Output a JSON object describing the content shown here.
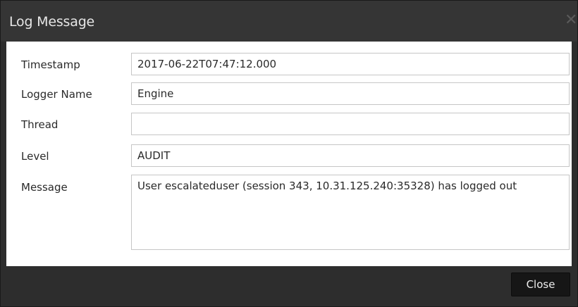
{
  "dialog": {
    "title": "Log Message",
    "close_icon": "close-icon",
    "close_glyph": "✕"
  },
  "fields": {
    "timestamp": {
      "label": "Timestamp",
      "value": "2017-06-22T07:47:12.000"
    },
    "logger_name": {
      "label": "Logger Name",
      "value": "Engine"
    },
    "thread": {
      "label": "Thread",
      "value": ""
    },
    "level": {
      "label": "Level",
      "value": "AUDIT"
    },
    "message": {
      "label": "Message",
      "value": "User escalateduser (session 343, 10.31.125.240:35328) has logged out"
    }
  },
  "footer": {
    "close_label": "Close"
  },
  "colors": {
    "titlebar": "#353535",
    "frame": "#2d2d2d",
    "button": "#161616",
    "field_border": "#c6c6c6"
  }
}
